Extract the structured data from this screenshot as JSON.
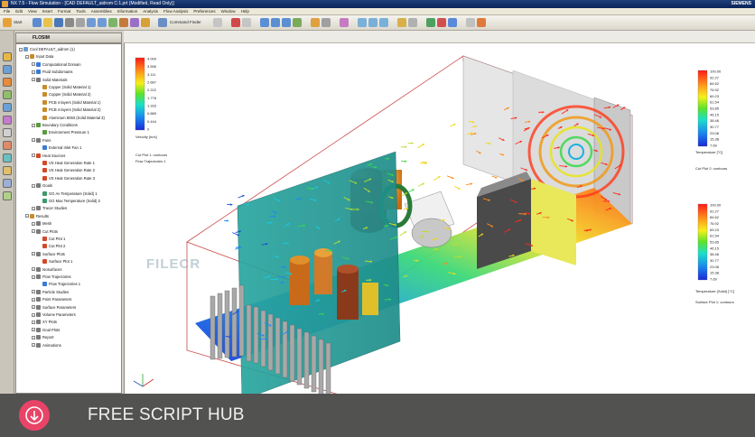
{
  "window": {
    "title": "NX 7.5 - Flow Simulation - [CAD DEFAULT_aidrom C:1.prt (Modified, Read Only)]",
    "brand": "SIEMENS"
  },
  "menu": [
    "File",
    "Edit",
    "View",
    "Insert",
    "Format",
    "Tools",
    "Assemblies",
    "Information",
    "Analysis",
    "Flow Analysis",
    "Preferences",
    "Window",
    "Help"
  ],
  "toolbar": {
    "start_label": "Start",
    "command_finder_label": "Command Finder"
  },
  "tree": {
    "header": "FLOSIM",
    "rows": [
      {
        "label": "Cool DEFAULT_aidrom (1)",
        "indent": 0,
        "color": "#6a9bd1"
      },
      {
        "label": "Input Data",
        "indent": 1,
        "color": "#c98a2a"
      },
      {
        "label": "Computational Domain",
        "indent": 2,
        "color": "#3a7bd5"
      },
      {
        "label": "Fluid Subdomains",
        "indent": 2,
        "color": "#3a7bd5"
      },
      {
        "label": "Solid Materials",
        "indent": 2,
        "color": "#7a7a7a"
      },
      {
        "label": "Copper (Solid Material 1)",
        "indent": 3,
        "color": "#c98a2a"
      },
      {
        "label": "Copper (Solid Material 2)",
        "indent": 3,
        "color": "#c98a2a"
      },
      {
        "label": "PCB 4-layers (Solid Material 1)",
        "indent": 3,
        "color": "#c98a2a"
      },
      {
        "label": "PCB 4-layers (Solid Material 2)",
        "indent": 3,
        "color": "#c98a2a"
      },
      {
        "label": "Aluminum 6063 (Solid Material 3)",
        "indent": 3,
        "color": "#c98a2a"
      },
      {
        "label": "Boundary Conditions",
        "indent": 2,
        "color": "#5a9a3a"
      },
      {
        "label": "Environment Pressure 1",
        "indent": 3,
        "color": "#5a9a3a"
      },
      {
        "label": "Fans",
        "indent": 2,
        "color": "#7a7a7a"
      },
      {
        "label": "External Inlet Fan 1",
        "indent": 3,
        "color": "#3a7bd5"
      },
      {
        "label": "Heat Sources",
        "indent": 2,
        "color": "#d24a2a"
      },
      {
        "label": "VS Heat Generation Rate 1",
        "indent": 3,
        "color": "#d24a2a"
      },
      {
        "label": "VS Heat Generation Rate 2",
        "indent": 3,
        "color": "#d24a2a"
      },
      {
        "label": "VS Heat Generation Rate 3",
        "indent": 3,
        "color": "#d24a2a"
      },
      {
        "label": "Goals",
        "indent": 2,
        "color": "#7a7a7a"
      },
      {
        "label": "GG Av Temperature (Solid) 1",
        "indent": 3,
        "color": "#3a9a6a"
      },
      {
        "label": "GG Max Temperature (Solid) 2",
        "indent": 3,
        "color": "#3a9a6a"
      },
      {
        "label": "Tracer Studies",
        "indent": 2,
        "color": "#7a7a7a"
      },
      {
        "label": "Results",
        "indent": 1,
        "color": "#c98a2a"
      },
      {
        "label": "Mesh",
        "indent": 2,
        "color": "#7a7a7a"
      },
      {
        "label": "Cut Plots",
        "indent": 2,
        "color": "#7a7a7a"
      },
      {
        "label": "Cut Plot 1",
        "indent": 3,
        "color": "#d24a2a"
      },
      {
        "label": "Cut Plot 2",
        "indent": 3,
        "color": "#d24a2a"
      },
      {
        "label": "Surface Plots",
        "indent": 2,
        "color": "#7a7a7a"
      },
      {
        "label": "Surface Plot 1",
        "indent": 3,
        "color": "#d24a2a"
      },
      {
        "label": "Isosurfaces",
        "indent": 2,
        "color": "#7a7a7a"
      },
      {
        "label": "Flow Trajectories",
        "indent": 2,
        "color": "#7a7a7a"
      },
      {
        "label": "Flow Trajectories 1",
        "indent": 3,
        "color": "#3a7bd5"
      },
      {
        "label": "Particle Studies",
        "indent": 2,
        "color": "#7a7a7a"
      },
      {
        "label": "Point Parameters",
        "indent": 2,
        "color": "#7a7a7a"
      },
      {
        "label": "Surface Parameters",
        "indent": 2,
        "color": "#7a7a7a"
      },
      {
        "label": "Volume Parameters",
        "indent": 2,
        "color": "#7a7a7a"
      },
      {
        "label": "XY Plots",
        "indent": 2,
        "color": "#7a7a7a"
      },
      {
        "label": "Goal Plots",
        "indent": 2,
        "color": "#7a7a7a"
      },
      {
        "label": "Report",
        "indent": 2,
        "color": "#7a7a7a"
      },
      {
        "label": "Animations",
        "indent": 2,
        "color": "#7a7a7a"
      }
    ]
  },
  "legends": {
    "velocity": {
      "values": [
        "4.000",
        "3.556",
        "3.111",
        "2.667",
        "2.222",
        "1.778",
        "1.333",
        "0.889",
        "0.444",
        "0"
      ],
      "unit": "Velocity [m/s]",
      "caption1": "Cut Plot 1: contours",
      "caption2": "Flow Trajectories 1"
    },
    "temperature_top": {
      "values": [
        "100.00",
        "92.27",
        "84.62",
        "76.92",
        "69.23",
        "61.54",
        "53.85",
        "46.15",
        "38.46",
        "30.77",
        "23.08",
        "15.38",
        "7.69"
      ],
      "unit": "Temperature [°C]",
      "caption": "Cut Plot 2: contours"
    },
    "temperature_bottom": {
      "values": [
        "100.00",
        "92.27",
        "84.62",
        "76.92",
        "69.23",
        "61.54",
        "53.85",
        "46.15",
        "38.46",
        "30.77",
        "23.08",
        "15.38",
        "7.69"
      ],
      "unit": "Temperature (Solid) [°C]",
      "caption": "Surface Plot 1: contours"
    }
  },
  "watermark": "FILECR",
  "footer": {
    "text": "FREE SCRIPT HUB",
    "icon": "download-icon",
    "accent": "#e94467"
  }
}
